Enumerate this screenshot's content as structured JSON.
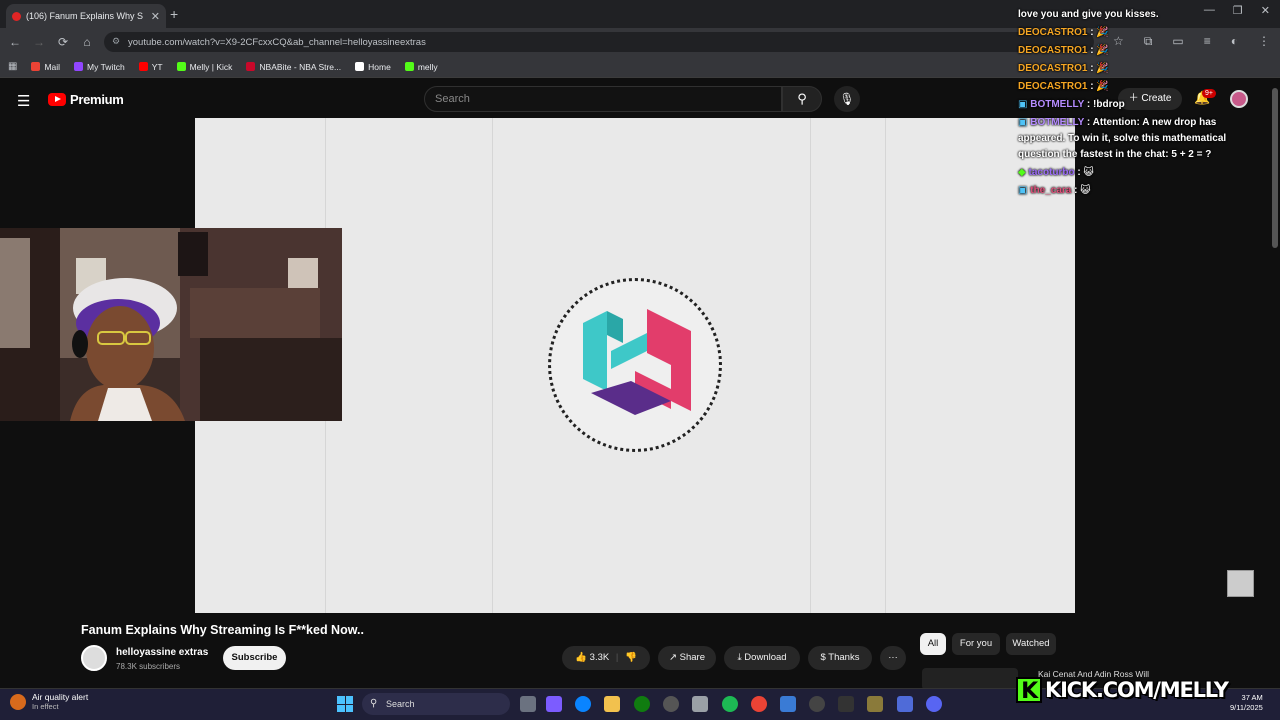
{
  "browser": {
    "tab_title": "(106) Fanum Explains Why S",
    "new_tab": "+",
    "url": "youtube.com/watch?v=X9-2CFcxxCQ&ab_channel=helloyassineextras",
    "bookmarks": [
      {
        "label": "Mail",
        "color": "#ea4335"
      },
      {
        "label": "My Twitch",
        "color": "#9146ff"
      },
      {
        "label": "YT",
        "color": "#ff0000"
      },
      {
        "label": "Melly | Kick",
        "color": "#53fc18"
      },
      {
        "label": "NBABite - NBA Stre...",
        "color": "#c9082a"
      },
      {
        "label": "Home",
        "color": "#ffffff"
      },
      {
        "label": "melly",
        "color": "#53fc18"
      }
    ]
  },
  "youtube": {
    "brand": "Premium",
    "search_placeholder": "Search",
    "create_label": "Create",
    "notifications": "9+",
    "video_title": "Fanum Explains Why Streaming Is F**ked Now..",
    "channel_name": "helloyassine extras",
    "subscribers": "78.3K subscribers",
    "subscribe_label": "Subscribe",
    "likes": "3.3K",
    "share_label": "Share",
    "download_label": "Download",
    "thanks_label": "Thanks",
    "more_label": "···",
    "chips": [
      "All",
      "For you",
      "Watched"
    ],
    "recommendation_title": "Kai Cenat And Adin Ross Will"
  },
  "chat": {
    "lines": [
      {
        "user": "",
        "text": "love you and give you kisses.",
        "color": "#ffffff"
      },
      {
        "user": "DEOCASTRO1",
        "text": ": 🎉",
        "color": "#f5a623"
      },
      {
        "user": "DEOCASTRO1",
        "text": ": 🎉",
        "color": "#f5a623"
      },
      {
        "user": "DEOCASTRO1",
        "text": ": 🎉",
        "color": "#f5a623"
      },
      {
        "user": "DEOCASTRO1",
        "text": ": 🎉",
        "color": "#f5a623"
      },
      {
        "user": "BOTMELLY",
        "text": ": !bdrop",
        "color": "#b58cff"
      },
      {
        "user": "BOTMELLY",
        "text": ": Attention: A new drop has",
        "color": "#b58cff"
      },
      {
        "user": "",
        "text": "appeared. To win it, solve this mathematical",
        "color": "#ffffff"
      },
      {
        "user": "",
        "text": "question the fastest in the chat: 5 + 2 = ?",
        "color": "#ffffff"
      },
      {
        "user": "tacoturbo",
        "text": ": 😺",
        "color": "#9b6cf7"
      },
      {
        "user": "the_cara",
        "text": ": 😺",
        "color": "#e0507a"
      }
    ]
  },
  "overlay": {
    "kick_text": "KICK.COM/MELLY",
    "kick_letter": "K",
    "kick_color": "#53fc18"
  },
  "taskbar": {
    "alert_title": "Air quality alert",
    "alert_sub": "In effect",
    "search_label": "Search",
    "time": "37 AM",
    "date": "9/11/2025"
  }
}
